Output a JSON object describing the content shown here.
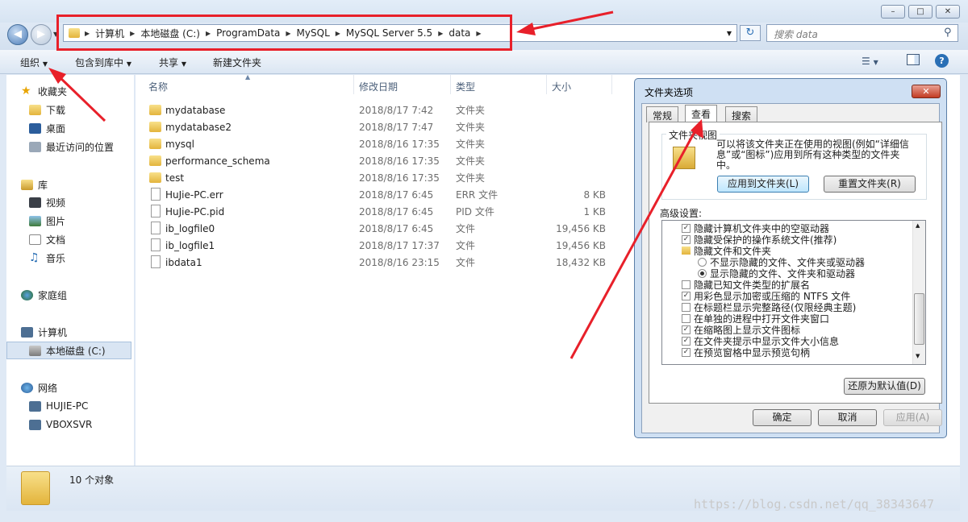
{
  "window": {
    "min_label": "–",
    "max_label": "□",
    "close_label": "✕"
  },
  "nav": {
    "back_icon": "back-arrow-icon",
    "forward_icon": "forward-arrow-icon"
  },
  "address": {
    "crumbs": [
      "计算机",
      "本地磁盘 (C:)",
      "ProgramData",
      "MySQL",
      "MySQL Server 5.5",
      "data"
    ]
  },
  "search": {
    "placeholder": "搜索 data"
  },
  "toolbar": {
    "organize": "组织",
    "include_library": "包含到库中",
    "share": "共享",
    "new_folder": "新建文件夹"
  },
  "sidebar": {
    "favorites": "收藏夹",
    "downloads": "下载",
    "desktop": "桌面",
    "recent": "最近访问的位置",
    "libraries": "库",
    "videos": "视频",
    "pictures": "图片",
    "documents": "文档",
    "music": "音乐",
    "homegroup": "家庭组",
    "computer": "计算机",
    "local_disk": "本地磁盘 (C:)",
    "network": "网络",
    "host1": "HUJIE-PC",
    "host2": "VBOXSVR"
  },
  "columns": {
    "name": "名称",
    "date": "修改日期",
    "type": "类型",
    "size": "大小"
  },
  "files": [
    {
      "name": "mydatabase",
      "date": "2018/8/17 7:42",
      "type": "文件夹",
      "size": "",
      "kind": "folder"
    },
    {
      "name": "mydatabase2",
      "date": "2018/8/17 7:47",
      "type": "文件夹",
      "size": "",
      "kind": "folder"
    },
    {
      "name": "mysql",
      "date": "2018/8/16 17:35",
      "type": "文件夹",
      "size": "",
      "kind": "folder"
    },
    {
      "name": "performance_schema",
      "date": "2018/8/16 17:35",
      "type": "文件夹",
      "size": "",
      "kind": "folder"
    },
    {
      "name": "test",
      "date": "2018/8/16 17:35",
      "type": "文件夹",
      "size": "",
      "kind": "folder"
    },
    {
      "name": "HuJie-PC.err",
      "date": "2018/8/17 6:45",
      "type": "ERR 文件",
      "size": "8 KB",
      "kind": "file"
    },
    {
      "name": "HuJie-PC.pid",
      "date": "2018/8/17 6:45",
      "type": "PID 文件",
      "size": "1 KB",
      "kind": "file"
    },
    {
      "name": "ib_logfile0",
      "date": "2018/8/17 6:45",
      "type": "文件",
      "size": "19,456 KB",
      "kind": "file"
    },
    {
      "name": "ib_logfile1",
      "date": "2018/8/17 17:37",
      "type": "文件",
      "size": "19,456 KB",
      "kind": "file"
    },
    {
      "name": "ibdata1",
      "date": "2018/8/16 23:15",
      "type": "文件",
      "size": "18,432 KB",
      "kind": "file"
    }
  ],
  "status": {
    "count": "10 个对象"
  },
  "dialog": {
    "title": "文件夹选项",
    "tabs": [
      "常规",
      "查看",
      "搜索"
    ],
    "group_title": "文件夹视图",
    "group_desc": "可以将该文件夹正在使用的视图(例如“详细信息”或“图标”)应用到所有这种类型的文件夹中。",
    "apply_btn": "应用到文件夹(L)",
    "reset_btn": "重置文件夹(R)",
    "advanced_label": "高级设置:",
    "settings": [
      {
        "label": "隐藏计算机文件夹中的空驱动器",
        "state": "checked"
      },
      {
        "label": "隐藏受保护的操作系统文件(推荐)",
        "state": "checked"
      },
      {
        "label": "隐藏文件和文件夹",
        "state": "folder"
      },
      {
        "label": "不显示隐藏的文件、文件夹或驱动器",
        "state": "radio-off"
      },
      {
        "label": "显示隐藏的文件、文件夹和驱动器",
        "state": "radio-on"
      },
      {
        "label": "隐藏已知文件类型的扩展名",
        "state": "unchecked"
      },
      {
        "label": "用彩色显示加密或压缩的 NTFS 文件",
        "state": "checked"
      },
      {
        "label": "在标题栏显示完整路径(仅限经典主题)",
        "state": "unchecked"
      },
      {
        "label": "在单独的进程中打开文件夹窗口",
        "state": "unchecked"
      },
      {
        "label": "在缩略图上显示文件图标",
        "state": "checked"
      },
      {
        "label": "在文件夹提示中显示文件大小信息",
        "state": "checked"
      },
      {
        "label": "在预览窗格中显示预览句柄",
        "state": "checked"
      }
    ],
    "restore_btn": "还原为默认值(D)",
    "ok_btn": "确定",
    "cancel_btn": "取消",
    "apply_main_btn": "应用(A)"
  },
  "watermark": "https://blog.csdn.net/qq_38343647",
  "colors": {
    "annotation": "#e8202a",
    "accent": "#3c7fb1"
  }
}
